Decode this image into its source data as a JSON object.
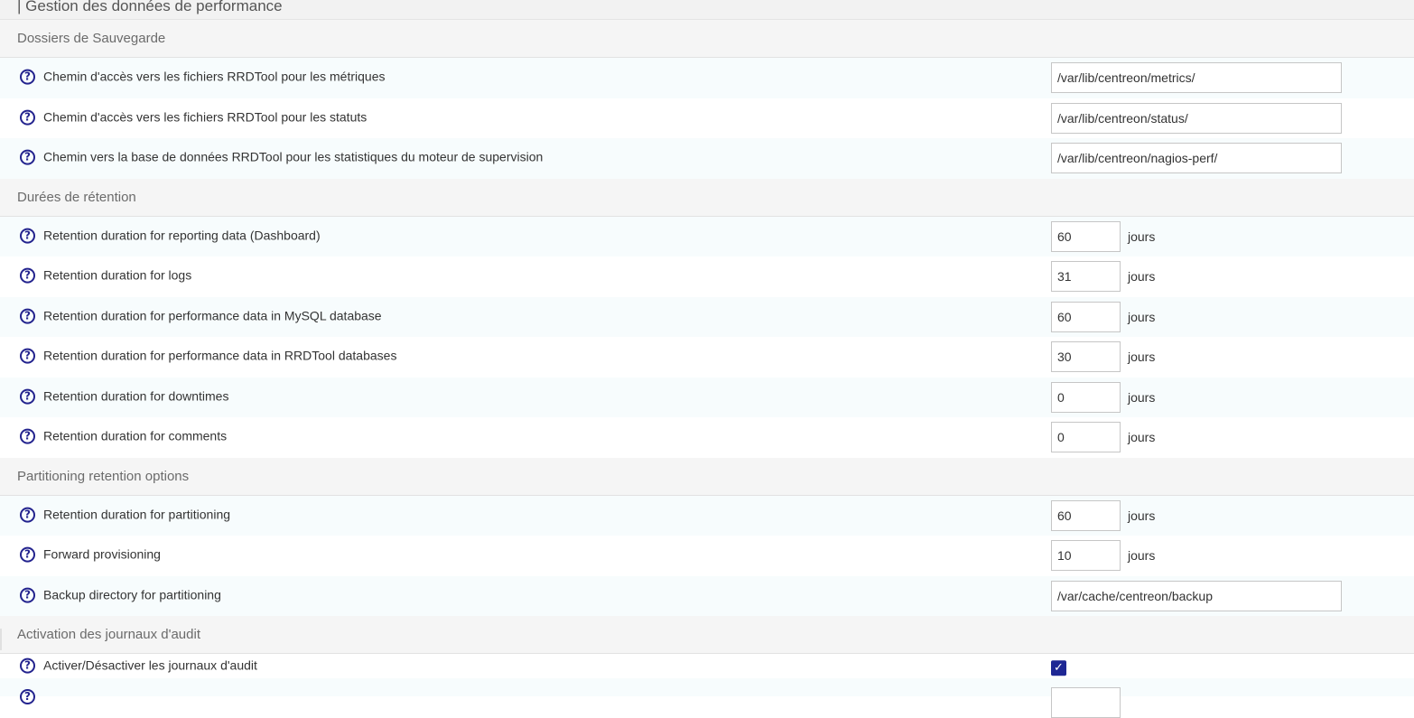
{
  "page": {
    "title": "| Gestion des données de performance"
  },
  "sections": [
    {
      "title": "Dossiers de Sauvegarde",
      "rows": [
        {
          "label": "Chemin d'accès vers les fichiers RRDTool pour les métriques",
          "value": "/var/lib/centreon/metrics/"
        },
        {
          "label": "Chemin d'accès vers les fichiers RRDTool pour les statuts",
          "value": "/var/lib/centreon/status/"
        },
        {
          "label": "Chemin vers la base de données RRDTool pour les statistiques du moteur de supervision",
          "value": "/var/lib/centreon/nagios-perf/"
        }
      ]
    },
    {
      "title": "Durées de rétention",
      "rows": [
        {
          "label": "Retention duration for reporting data (Dashboard)",
          "value": "60",
          "unit": "jours"
        },
        {
          "label": "Retention duration for logs",
          "value": "31",
          "unit": "jours"
        },
        {
          "label": "Retention duration for performance data in MySQL database",
          "value": "60",
          "unit": "jours"
        },
        {
          "label": "Retention duration for performance data in RRDTool databases",
          "value": "30",
          "unit": "jours"
        },
        {
          "label": "Retention duration for downtimes",
          "value": "0",
          "unit": "jours"
        },
        {
          "label": "Retention duration for comments",
          "value": "0",
          "unit": "jours"
        }
      ]
    },
    {
      "title": "Partitioning retention options",
      "rows": [
        {
          "label": "Retention duration for partitioning",
          "value": "60",
          "unit": "jours"
        },
        {
          "label": "Forward provisioning",
          "value": "10",
          "unit": "jours"
        },
        {
          "label": "Backup directory for partitioning",
          "value": "/var/cache/centreon/backup"
        }
      ]
    },
    {
      "title": "Activation des journaux d'audit",
      "rows": [
        {
          "label": "Activer/Désactiver les journaux d'audit",
          "checked": true
        }
      ]
    }
  ],
  "icons": {
    "help": "question-circle-icon",
    "check": "checkmark-icon"
  },
  "colors": {
    "accent": "#1d2794",
    "help_icon": "#23238e"
  }
}
